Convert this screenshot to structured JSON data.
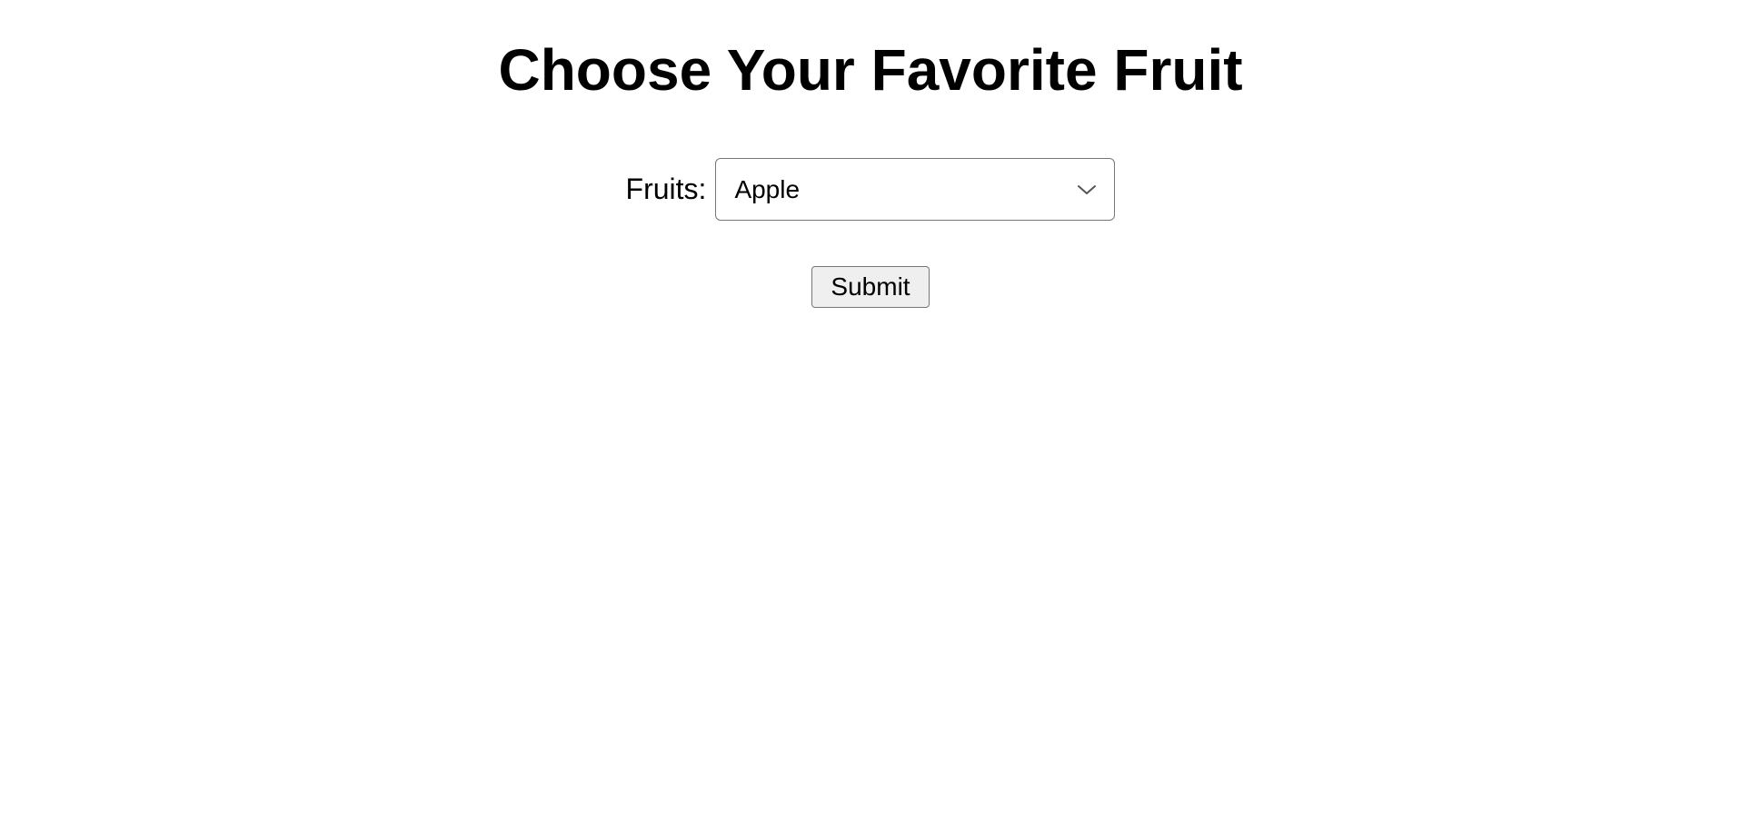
{
  "page": {
    "title": "Choose Your Favorite Fruit"
  },
  "form": {
    "label": "Fruits:",
    "select": {
      "selected": "Apple"
    },
    "submit_label": "Submit"
  }
}
